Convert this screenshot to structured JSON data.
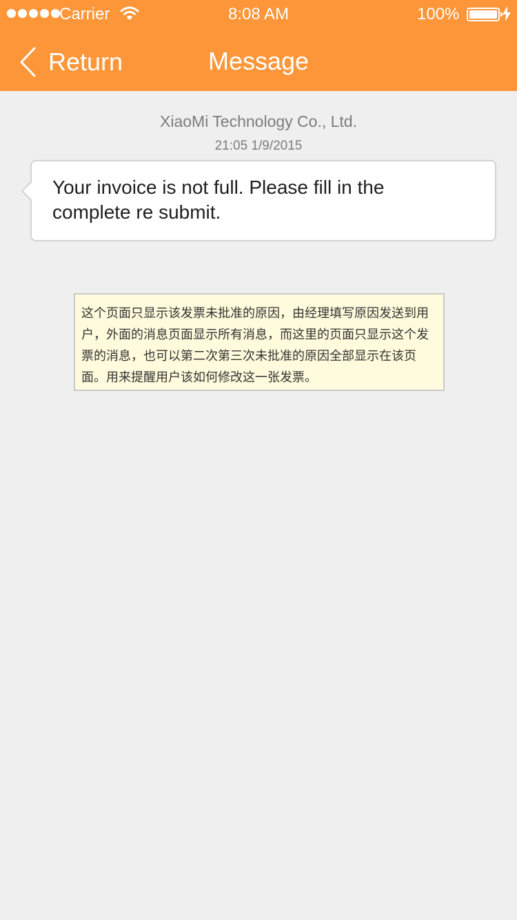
{
  "status_bar": {
    "carrier": "Carrier",
    "time": "8:08 AM",
    "battery": "100%"
  },
  "nav": {
    "back_label": "Return",
    "title": "Message"
  },
  "message": {
    "sender": "XiaoMi Technology Co., Ltd.",
    "timestamp": "21:05 1/9/2015",
    "body": "Your invoice is not full. Please fill in the complete re submit."
  },
  "annotation": {
    "text": "这个页面只显示该发票未批准的原因，由经理填写原因发送到用户，外面的消息页面显示所有消息，而这里的页面只显示这个发票的消息，也可以第二次第三次未批准的原因全部显示在该页面。用来提醒用户该如何修改这一张发票。"
  },
  "colors": {
    "header": "#fd9639",
    "background": "#efefef",
    "note_background": "#fffbdc"
  },
  "icons": {
    "back": "chevron-left-icon",
    "wifi": "wifi-icon",
    "battery": "battery-icon",
    "charging": "lightning-bolt-icon"
  }
}
